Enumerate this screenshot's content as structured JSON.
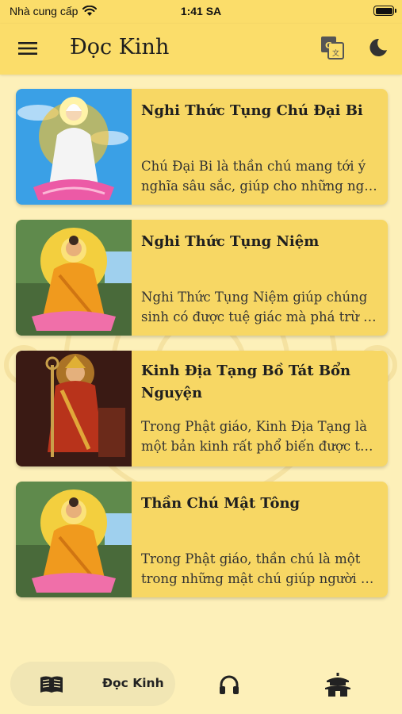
{
  "status_bar": {
    "carrier": "Nhà cung cấp",
    "time": "1:41 SA"
  },
  "app_bar": {
    "title": "Đọc Kinh"
  },
  "items": [
    {
      "title": "Nghi Thức Tụng Chú Đại Bi",
      "desc1": "Chú Đại Bi là thần chú mang tới ý",
      "desc2": "nghĩa sâu sắc, giúp cho những ng…"
    },
    {
      "title": "Nghi Thức Tụng Niệm",
      "desc1": "Nghi Thức Tụng Niệm giúp chúng",
      "desc2": "sinh có được tuệ giác mà phá trừ t…"
    },
    {
      "title": "Kinh Địa Tạng Bồ Tát Bổn Nguyện",
      "desc1": "Trong Phật giáo, Kinh Địa Tạng là",
      "desc2": "một bản kinh rất phổ biến được tr…"
    },
    {
      "title": "Thần Chú Mật Tông",
      "desc1": "Trong Phật giáo, thần chú là một",
      "desc2": "trong những mật chú giúp người t…"
    }
  ],
  "bottom_nav": {
    "active_label": "Đọc Kinh"
  },
  "icons": {
    "menu": "menu-icon",
    "translate": "translate-icon",
    "theme": "moon-icon",
    "read": "book-icon",
    "listen": "headphones-icon",
    "temple": "temple-icon"
  },
  "colors": {
    "bar": "#fbdd6a",
    "card": "#f7d764",
    "background": "#fdf0b9"
  }
}
